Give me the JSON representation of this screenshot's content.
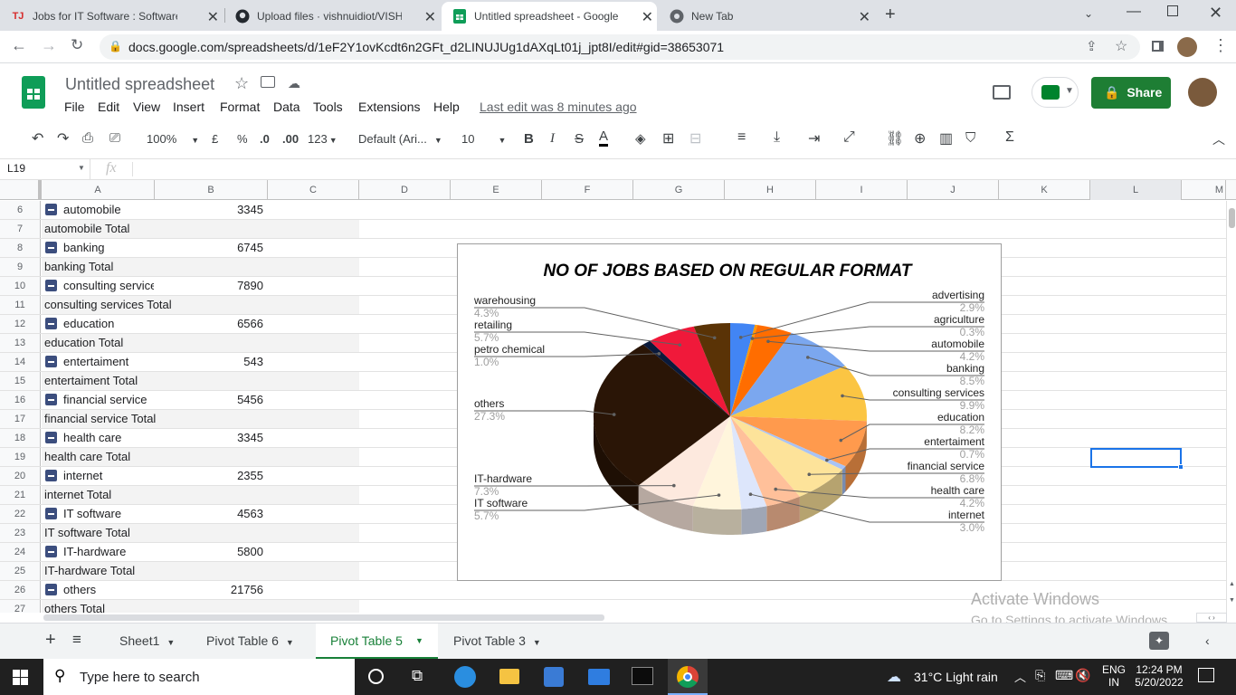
{
  "browser": {
    "tabs": [
      {
        "title": "Jobs for IT Software : Software Pr",
        "icon": "tj-logo-icon"
      },
      {
        "title": "Upload files · vishnuidiot/VISHNU",
        "icon": "github-icon"
      },
      {
        "title": "Untitled spreadsheet - Google Sh",
        "icon": "sheets-icon"
      },
      {
        "title": "New Tab",
        "icon": "chrome-icon"
      }
    ],
    "url": "docs.google.com/spreadsheets/d/1eF2Y1ovKcdt6n2GFt_d2LINUJUg1dAXqLt01j_jpt8I/edit#gid=38653071"
  },
  "sheets": {
    "doc_title": "Untitled spreadsheet",
    "menu": [
      "File",
      "Edit",
      "View",
      "Insert",
      "Format",
      "Data",
      "Tools",
      "Extensions",
      "Help"
    ],
    "last_edit": "Last edit was 8 minutes ago",
    "share_label": "Share",
    "toolbar": {
      "zoom": "100%",
      "currency": "£",
      "percent": "%",
      "dec_less": ".0",
      "dec_more": ".00",
      "num_format": "123",
      "font": "Default (Ari...",
      "font_size": "10"
    },
    "name_box": "L19",
    "fx": "fx",
    "columns": [
      "A",
      "B",
      "C",
      "D",
      "E",
      "F",
      "G",
      "H",
      "I",
      "J",
      "K",
      "L",
      "M"
    ],
    "rows": [
      {
        "n": "6",
        "a": "automobile",
        "b": "3345",
        "group": true
      },
      {
        "n": "7",
        "a": "automobile Total",
        "b": "",
        "group": false
      },
      {
        "n": "8",
        "a": "banking",
        "b": "6745",
        "group": true
      },
      {
        "n": "9",
        "a": "banking Total",
        "b": "",
        "group": false
      },
      {
        "n": "10",
        "a": "consulting service",
        "b": "7890",
        "group": true
      },
      {
        "n": "11",
        "a": "consulting services Total",
        "b": "",
        "group": false
      },
      {
        "n": "12",
        "a": "education",
        "b": "6566",
        "group": true
      },
      {
        "n": "13",
        "a": "education Total",
        "b": "",
        "group": false
      },
      {
        "n": "14",
        "a": "entertaiment",
        "b": "543",
        "group": true
      },
      {
        "n": "15",
        "a": "entertaiment Total",
        "b": "",
        "group": false
      },
      {
        "n": "16",
        "a": "financial service",
        "b": "5456",
        "group": true
      },
      {
        "n": "17",
        "a": "financial service Total",
        "b": "",
        "group": false
      },
      {
        "n": "18",
        "a": "health care",
        "b": "3345",
        "group": true
      },
      {
        "n": "19",
        "a": "health care Total",
        "b": "",
        "group": false
      },
      {
        "n": "20",
        "a": "internet",
        "b": "2355",
        "group": true
      },
      {
        "n": "21",
        "a": "internet Total",
        "b": "",
        "group": false
      },
      {
        "n": "22",
        "a": "IT software",
        "b": "4563",
        "group": true
      },
      {
        "n": "23",
        "a": "IT software Total",
        "b": "",
        "group": false
      },
      {
        "n": "24",
        "a": "IT-hardware",
        "b": "5800",
        "group": true
      },
      {
        "n": "25",
        "a": "IT-hardware  Total",
        "b": "",
        "group": false
      },
      {
        "n": "26",
        "a": "others",
        "b": "21756",
        "group": true
      },
      {
        "n": "27",
        "a": "others Total",
        "b": "",
        "group": false
      }
    ],
    "sheet_tabs": [
      "Sheet1",
      "Pivot Table 6",
      "Pivot Table 5",
      "Pivot Table 3"
    ],
    "active_sheet": "Pivot Table 5",
    "watermark": {
      "line1": "Activate Windows",
      "line2": "Go to Settings to activate Windows."
    }
  },
  "chart_data": {
    "type": "pie",
    "title": "NO OF JOBS BASED ON REGULAR FORMAT",
    "slices": [
      {
        "label": "advertising",
        "pct": "2.9%",
        "value": 2.9,
        "color": "#4285f4"
      },
      {
        "label": "agriculture",
        "pct": "0.3%",
        "value": 0.3,
        "color": "#ff9900"
      },
      {
        "label": "automobile",
        "pct": "4.2%",
        "value": 4.2,
        "color": "#ff6d00"
      },
      {
        "label": "banking",
        "pct": "8.5%",
        "value": 8.5,
        "color": "#7ba7ef"
      },
      {
        "label": "consulting services",
        "pct": "9.9%",
        "value": 9.9,
        "color": "#fbc543"
      },
      {
        "label": "education",
        "pct": "8.2%",
        "value": 8.2,
        "color": "#ff9a4d"
      },
      {
        "label": "entertaiment",
        "pct": "0.7%",
        "value": 0.7,
        "color": "#a8c3f5"
      },
      {
        "label": "financial service",
        "pct": "6.8%",
        "value": 6.8,
        "color": "#fde39a"
      },
      {
        "label": "health care",
        "pct": "4.2%",
        "value": 4.2,
        "color": "#ffc09a"
      },
      {
        "label": "internet",
        "pct": "3.0%",
        "value": 3.0,
        "color": "#dde6fb"
      },
      {
        "label": "IT software",
        "pct": "5.7%",
        "value": 5.7,
        "color": "#fff5dc"
      },
      {
        "label": "IT-hardware",
        "pct": "7.3%",
        "value": 7.3,
        "color": "#fde9de"
      },
      {
        "label": "others",
        "pct": "27.3%",
        "value": 27.3,
        "color": "#2a1506"
      },
      {
        "label": "petro chemical",
        "pct": "1.0%",
        "value": 1.0,
        "color": "#0b1a3b"
      },
      {
        "label": "retailing",
        "pct": "5.7%",
        "value": 5.7,
        "color": "#f0193a"
      },
      {
        "label": "warehousing",
        "pct": "4.3%",
        "value": 4.3,
        "color": "#5a3306"
      }
    ]
  },
  "taskbar": {
    "search_placeholder": "Type here to search",
    "weather": "31°C  Light rain",
    "lang1": "ENG",
    "lang2": "IN",
    "time": "12:24 PM",
    "date": "5/20/2022"
  }
}
